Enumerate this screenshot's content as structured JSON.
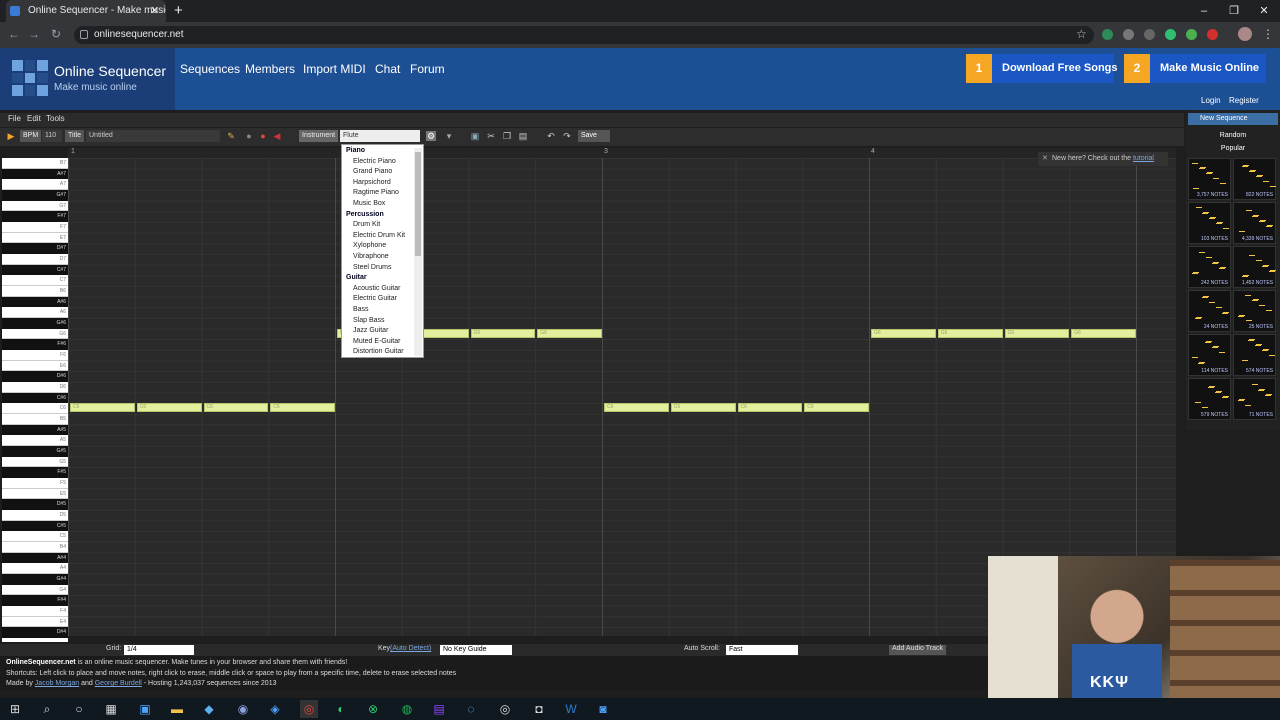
{
  "browser": {
    "tab_title": "Online Sequencer - Make music",
    "url": "onlinesequencer.net"
  },
  "site": {
    "title": "Online Sequencer",
    "subtitle": "Make music online",
    "nav": [
      "Sequences",
      "Members",
      "Import MIDI",
      "Chat",
      "Forum"
    ],
    "ads": [
      {
        "num": "1",
        "label": "Download Free Songs"
      },
      {
        "num": "2",
        "label": "Make Music Online"
      }
    ],
    "login": "Login",
    "register": "Register"
  },
  "menu": [
    "File",
    "Edit",
    "Tools"
  ],
  "toolbar": {
    "bpm_label": "BPM",
    "bpm_value": "110",
    "title_label": "Title",
    "title_value": "Untitled",
    "instrument_label": "Instrument",
    "instrument_value": "Flute",
    "save_label": "Save"
  },
  "ruler": [
    "1",
    "3",
    "4"
  ],
  "piano_keys": [
    "B7",
    "A#7",
    "A7",
    "G#7",
    "G7",
    "F#7",
    "F7",
    "E7",
    "D#7",
    "D7",
    "C#7",
    "C7",
    "B6",
    "A#6",
    "A6",
    "G#6",
    "G6",
    "F#6",
    "F6",
    "E6",
    "D#6",
    "D6",
    "C#6",
    "C6",
    "B5",
    "A#5",
    "A5",
    "G#5",
    "G5",
    "F#5",
    "F5",
    "E5",
    "D#5",
    "D5",
    "C#5",
    "C5",
    "B4",
    "A#4",
    "A4",
    "G#4",
    "G4",
    "F#4",
    "F4",
    "E4",
    "D#4"
  ],
  "notes_row1": [
    "G6",
    "G6",
    "G6",
    "G6",
    "G6",
    "G6",
    "G6",
    "G6"
  ],
  "notes_row2": [
    "C6",
    "C6",
    "C6",
    "C6",
    "C6",
    "C6",
    "C6",
    "C6"
  ],
  "dropdown": [
    {
      "group": "Piano",
      "items": [
        "Electric Piano",
        "Grand Piano",
        "Harpsichord",
        "Ragtime Piano",
        "Music Box"
      ]
    },
    {
      "group": "Percussion",
      "items": [
        "Drum Kit",
        "Electric Drum Kit",
        "Xylophone",
        "Vibraphone",
        "Steel Drums"
      ]
    },
    {
      "group": "Guitar",
      "items": [
        "Acoustic Guitar",
        "Electric Guitar",
        "Bass",
        "Slap Bass",
        "Jazz Guitar",
        "Muted E-Guitar",
        "Distortion Guitar"
      ]
    }
  ],
  "hint": {
    "text": "New here? Check out the",
    "link": "tutorial"
  },
  "sidebar": {
    "new_sequence": "New Sequence",
    "random": "Random",
    "popular": "Popular",
    "thumbs": [
      "3,757 NOTES",
      "822 NOTES",
      "103 NOTES",
      "4,339 NOTES",
      "242 NOTES",
      "1,452 NOTES",
      "24 NOTES",
      "25 NOTES",
      "114 NOTES",
      "574 NOTES",
      "579 NOTES",
      "71 NOTES"
    ]
  },
  "bottom": {
    "grid_label": "Grid:",
    "grid_value": "1/4",
    "key_label": "Key",
    "key_link": "(Auto Detect)",
    "key_value": "No Key Guide",
    "autoscroll_label": "Auto Scroll:",
    "autoscroll_value": "Fast",
    "add_audio": "Add Audio Track"
  },
  "footer": {
    "line1_bold": "OnlineSequencer.net",
    "line1": " is an online music sequencer. Make tunes in your browser and share them with friends!",
    "line2": "Shortcuts: Left click to place and move notes, right click to erase, middle click or space to play from a specific time, delete to erase selected notes",
    "line3_a": "Made by ",
    "line3_author1": "Jacob Morgan",
    "line3_and": " and ",
    "line3_author2": "George Burdell",
    "line3_b": " - Hosting 1,243,037 sequences since 2013"
  },
  "webcam_shirt": "KKΨ"
}
